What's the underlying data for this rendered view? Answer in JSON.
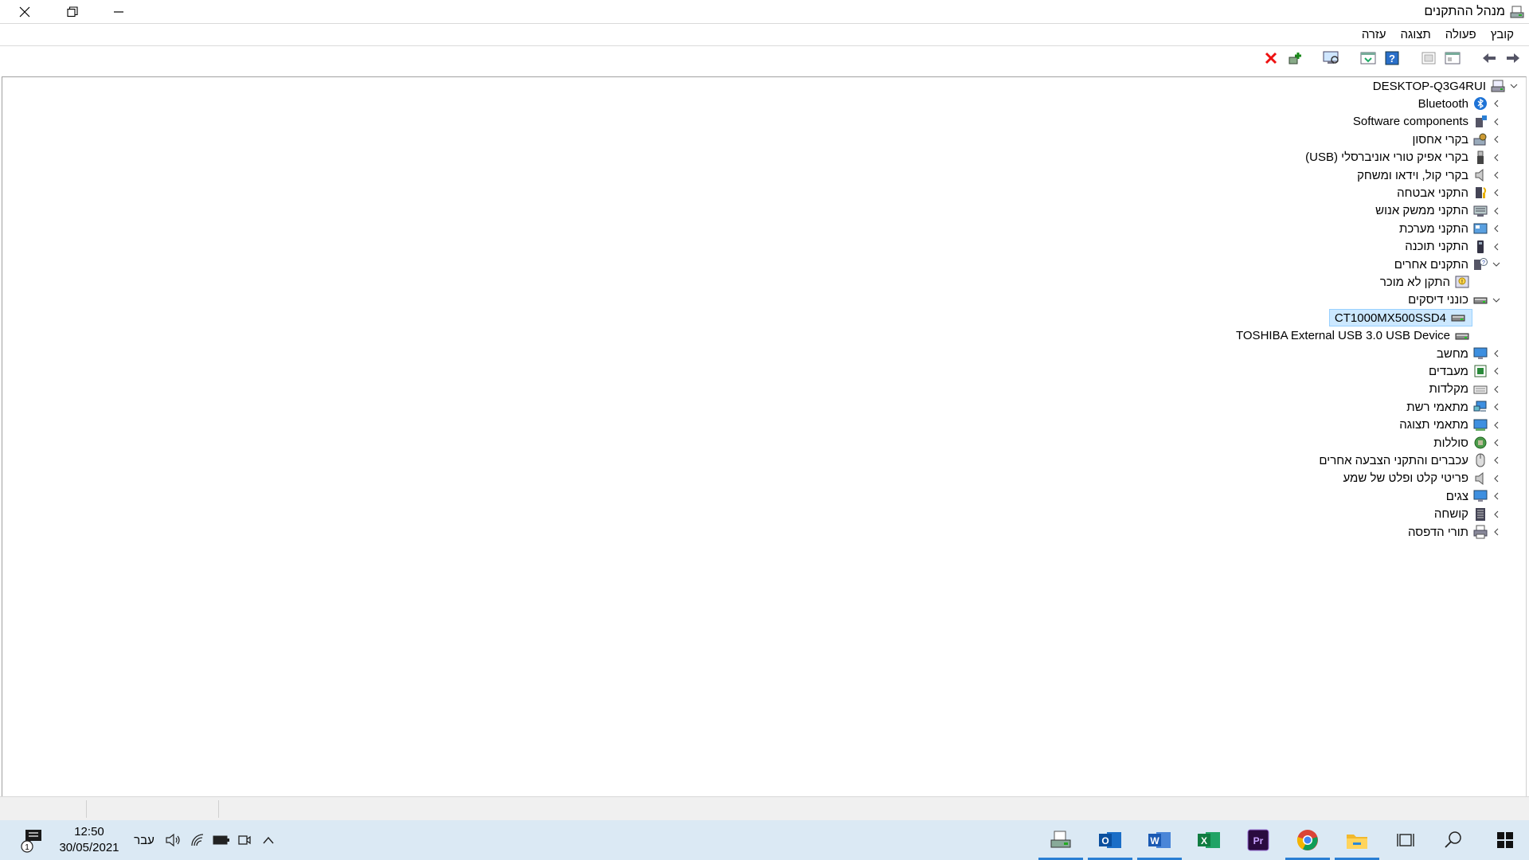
{
  "window": {
    "title": "מנהל ההתקנים"
  },
  "menu": [
    "קובץ",
    "פעולה",
    "תצוגה",
    "עזרה"
  ],
  "toolbar": {
    "buttons": [
      "back-arrow-icon",
      "forward-arrow-icon",
      "properties-icon",
      "show-hidden-icon",
      "help-icon",
      "update-driver-icon",
      "scan-hardware-icon",
      "add-legacy-icon",
      "uninstall-icon"
    ]
  },
  "tree": {
    "root": "DESKTOP-Q3G4RUI",
    "items": [
      {
        "label": "Bluetooth",
        "icon": "bluetooth-icon",
        "state": "collapsed",
        "level": 1
      },
      {
        "label": "Software components",
        "icon": "software-components-icon",
        "state": "collapsed",
        "level": 1
      },
      {
        "label": "בקרי אחסון",
        "icon": "storage-controller-icon",
        "state": "collapsed",
        "level": 1
      },
      {
        "label": "בקרי אפיק טורי אוניברסלי (USB)",
        "icon": "usb-icon",
        "state": "collapsed",
        "level": 1
      },
      {
        "label": "בקרי קול, וידאו ומשחק",
        "icon": "speaker-icon",
        "state": "collapsed",
        "level": 1
      },
      {
        "label": "התקני אבטחה",
        "icon": "security-icon",
        "state": "collapsed",
        "level": 1
      },
      {
        "label": "התקני ממשק אנוש",
        "icon": "hid-icon",
        "state": "collapsed",
        "level": 1
      },
      {
        "label": "התקני מערכת",
        "icon": "system-device-icon",
        "state": "collapsed",
        "level": 1
      },
      {
        "label": "התקני תוכנה",
        "icon": "software-device-icon",
        "state": "collapsed",
        "level": 1
      },
      {
        "label": "התקנים אחרים",
        "icon": "other-devices-icon",
        "state": "expanded",
        "level": 1
      },
      {
        "label": "התקן לא מוכר",
        "icon": "unknown-device-icon",
        "state": "leaf",
        "level": 2
      },
      {
        "label": "כונני דיסקים",
        "icon": "disk-drive-icon",
        "state": "expanded",
        "level": 1
      },
      {
        "label": "CT1000MX500SSD4",
        "icon": "disk-drive-icon",
        "state": "leaf",
        "level": 2,
        "selected": true
      },
      {
        "label": "TOSHIBA External USB 3.0 USB Device",
        "icon": "disk-drive-icon",
        "state": "leaf",
        "level": 2
      },
      {
        "label": "מחשב",
        "icon": "computer-icon",
        "state": "collapsed",
        "level": 1
      },
      {
        "label": "מעבדים",
        "icon": "processor-icon",
        "state": "collapsed",
        "level": 1
      },
      {
        "label": "מקלדות",
        "icon": "keyboard-icon",
        "state": "collapsed",
        "level": 1
      },
      {
        "label": "מתאמי רשת",
        "icon": "network-adapter-icon",
        "state": "collapsed",
        "level": 1
      },
      {
        "label": "מתאמי תצוגה",
        "icon": "display-adapter-icon",
        "state": "collapsed",
        "level": 1
      },
      {
        "label": "סוללות",
        "icon": "battery-icon",
        "state": "collapsed",
        "level": 1
      },
      {
        "label": "עכברים והתקני הצבעה אחרים",
        "icon": "mouse-icon",
        "state": "collapsed",
        "level": 1
      },
      {
        "label": "פריטי קלט ופלט של שמע",
        "icon": "audio-io-icon",
        "state": "collapsed",
        "level": 1
      },
      {
        "label": "צגים",
        "icon": "monitor-icon",
        "state": "collapsed",
        "level": 1
      },
      {
        "label": "קושחה",
        "icon": "firmware-icon",
        "state": "collapsed",
        "level": 1
      },
      {
        "label": "תורי הדפסה",
        "icon": "print-queue-icon",
        "state": "collapsed",
        "level": 1
      }
    ]
  },
  "taskbar": {
    "clock_time": "12:50",
    "clock_date": "30/05/2021",
    "language": "עבר",
    "notification_count": "1",
    "apps": [
      "windows-start-icon",
      "search-icon",
      "task-view-icon",
      "file-explorer-icon",
      "chrome-icon",
      "premiere-icon",
      "excel-icon",
      "word-icon",
      "outlook-icon",
      "device-manager-icon"
    ]
  },
  "colors": {
    "selection": "#cce8ff",
    "taskbar": "#dbe9f4",
    "accent": "#2a7fd4"
  }
}
